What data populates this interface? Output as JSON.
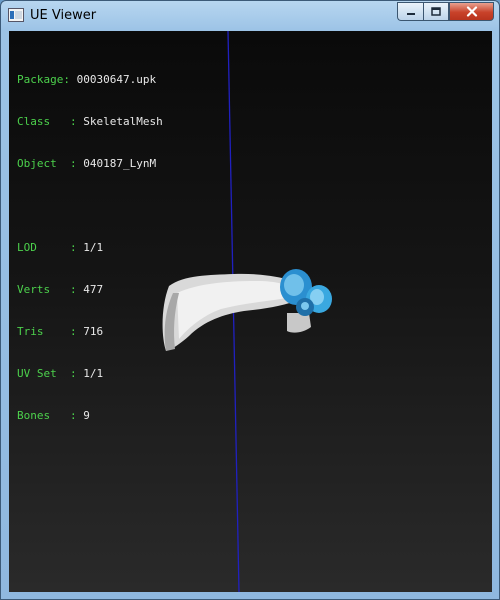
{
  "window": {
    "title": "UE Viewer"
  },
  "info": {
    "package_label": "Package: ",
    "package_value": "00030647.upk",
    "class_label": "Class   : ",
    "class_value": "SkeletalMesh",
    "object_label": "Object  : ",
    "object_value": "040187_LynM",
    "lod_label": "LOD     : ",
    "lod_value": "1/1",
    "verts_label": "Verts   : ",
    "verts_value": "477",
    "tris_label": "Tris    : ",
    "tris_value": "716",
    "uvset_label": "UV Set  : ",
    "uvset_value": "1/1",
    "bones_label": "Bones   : ",
    "bones_value": "9"
  },
  "colors": {
    "info_label": "#4cd14c",
    "info_value": "#e8e8e8",
    "axis": "#2020c0",
    "mesh": "#e6e6e6",
    "mesh_accent": "#3aa8e0"
  }
}
